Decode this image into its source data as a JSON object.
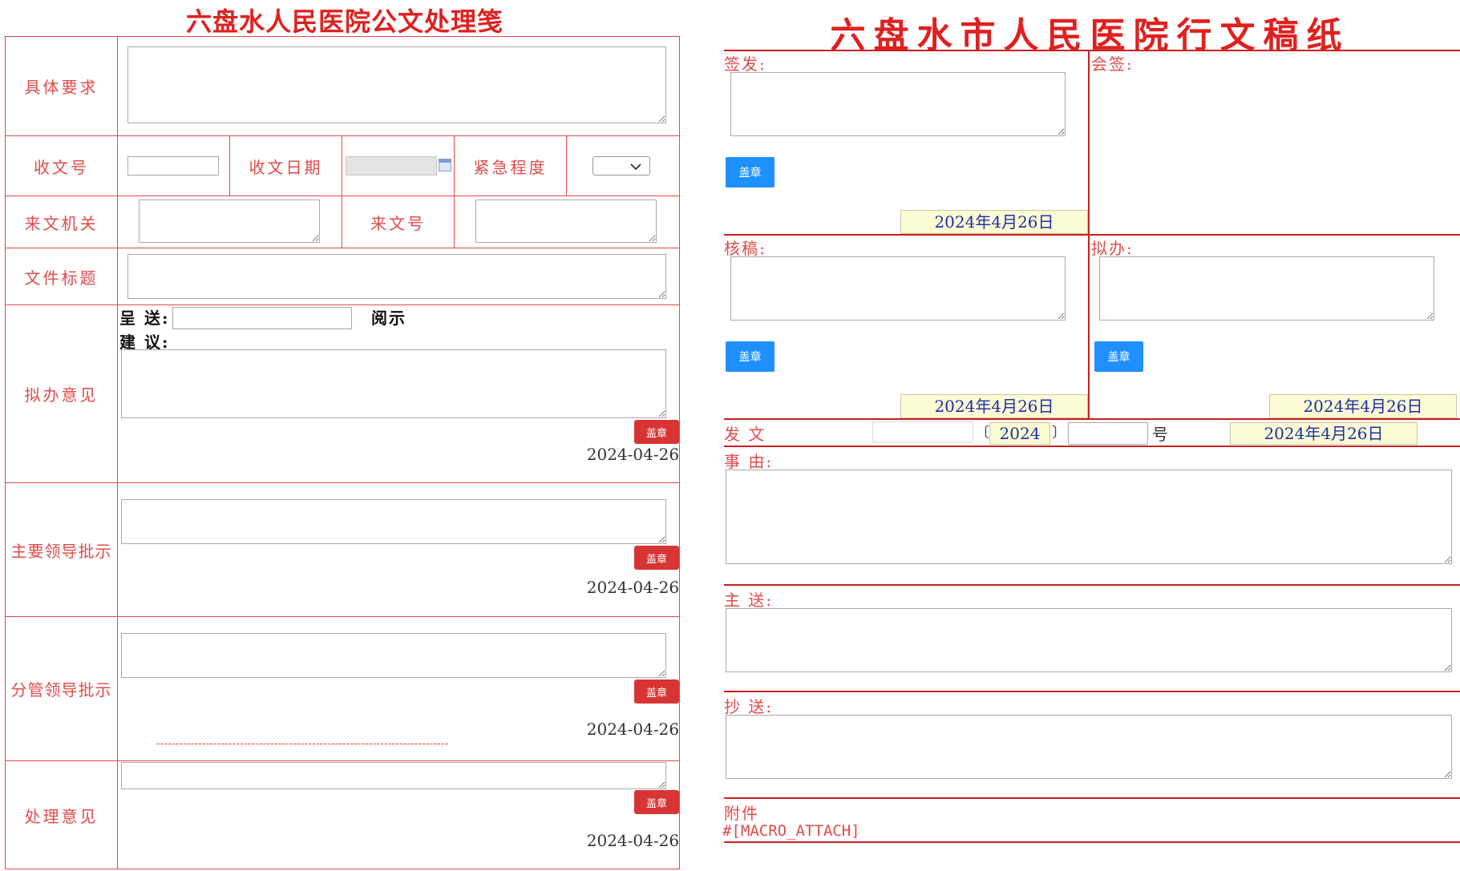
{
  "left": {
    "title": "六盘水人民医院公文处理笺",
    "labels": {
      "requirement": "具体要求",
      "receipt_no": "收文号",
      "receipt_date": "收文日期",
      "urgency": "紧急程度",
      "issuer": "来文机关",
      "doc_no": "来文号",
      "doc_title": "文件标题",
      "proposal": "拟办意见",
      "main_leader": "主要领导批示",
      "branch_leader": "分管领导批示",
      "handling": "处理意见"
    },
    "submit_label": "呈 送:",
    "review_label": "阅示",
    "suggest_label": "建 议:",
    "stamp_label": "盖章",
    "dates": [
      "2024-04-26",
      "2024-04-26",
      "2024-04-26",
      "2024-04-26"
    ],
    "dash_line": "-----------------------------------------------------------------------------",
    "urgency_value": ""
  },
  "right": {
    "title": "六盘水市人民医院行文稿纸",
    "labels": {
      "sign": "签发:",
      "countersign": "会签:",
      "review": "核稿:",
      "draft": "拟办:",
      "issue": "发 文",
      "reason": "事 由:",
      "main_send": "主 送:",
      "copy_send": "抄 送:",
      "attach": "附件",
      "attach_macro": "#[MACRO_ATTACH]",
      "number_suffix": "号",
      "bracket_open": "〔",
      "bracket_close": "〕"
    },
    "stamp_label": "盖章",
    "dates": {
      "sign_date": "2024年4月26日",
      "review_date": "2024年4月26日",
      "draft_date": "2024年4月26日",
      "issue_date": "2024年4月26日"
    },
    "issue_year": "2024"
  },
  "colors": {
    "label_red": "#e34a4a",
    "title_red": "#e02020",
    "stamp_red": "#d83434",
    "stamp_blue": "#1e90ff",
    "date_blue": "#1a2fa8",
    "date_bg": "#fcfcd4"
  }
}
